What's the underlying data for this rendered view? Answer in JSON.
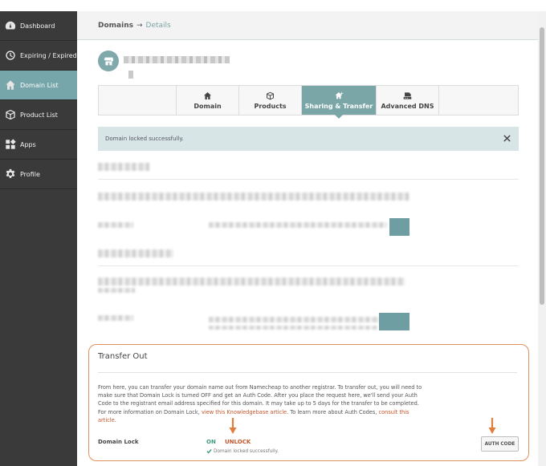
{
  "sidebar": {
    "items": [
      {
        "label": "Dashboard",
        "icon": "dashboard-icon"
      },
      {
        "label": "Expiring / Expired",
        "icon": "clock-icon"
      },
      {
        "label": "Domain List",
        "icon": "home-icon",
        "active": true
      },
      {
        "label": "Product List",
        "icon": "box-icon"
      },
      {
        "label": "Apps",
        "icon": "apps-icon"
      },
      {
        "label": "Profile",
        "icon": "gear-icon"
      }
    ]
  },
  "header": {
    "crumb_root": "Domains",
    "crumb_sep": "→",
    "crumb_current": "Details"
  },
  "tabs": [
    {
      "label": "Domain",
      "icon": "home-icon"
    },
    {
      "label": "Products",
      "icon": "box-icon"
    },
    {
      "label": "Sharing & Transfer",
      "icon": "share-home-icon",
      "active": true
    },
    {
      "label": "Advanced DNS",
      "icon": "dns-icon"
    }
  ],
  "alert": {
    "message": "Domain locked successfully."
  },
  "transfer": {
    "title": "Transfer Out",
    "desc_part1": "From here, you can transfer your domain name out from Namecheap to another registrar. To transfer out, you will need to make sure that Domain Lock is turned OFF and get an Auth Code. After you place the request here, we'll send your Auth Code to the registrant email address specified for this domain. It may take up to 5 days for the transfer to be completed. For more information on Domain Lock, ",
    "link1": "view this Knowledgebase article",
    "desc_part2": ". To learn more about Auth Codes, ",
    "link2": "consult this article",
    "desc_part3": ".",
    "lock_label": "Domain Lock",
    "on_label": "ON",
    "unlock_label": "UNLOCK",
    "lock_status": "Domain locked successfully.",
    "auth_button": "AUTH CODE"
  },
  "colors": {
    "accent": "#7aa6a8",
    "sidebar": "#3a3a3a",
    "highlight_border": "#e0905e",
    "link": "#c2562c",
    "on_green": "#3f9c7c"
  }
}
